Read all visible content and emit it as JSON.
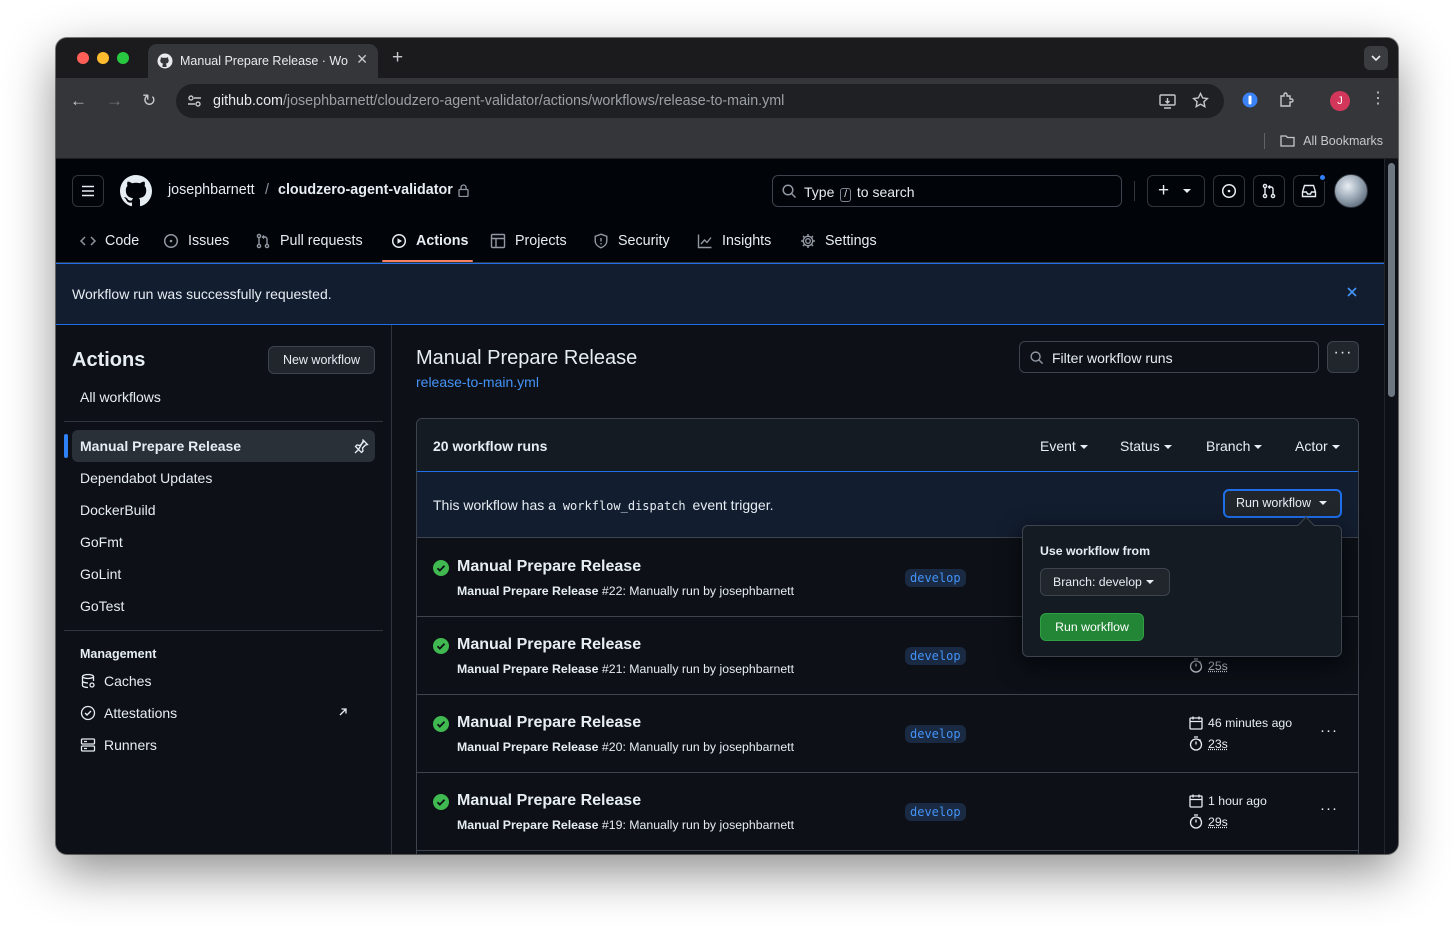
{
  "browser": {
    "tab_title": "Manual Prepare Release · Workflow runs",
    "url_domain": "github.com",
    "url_path": "/josephbarnett/cloudzero-agent-validator/actions/workflows/release-to-main.yml",
    "bookmarks_label": "All Bookmarks",
    "profile_initial": "J"
  },
  "header": {
    "owner": "josephbarnett",
    "separator": "/",
    "repo": "cloudzero-agent-validator",
    "search_prefix": "Type",
    "search_key": "/",
    "search_suffix": "to search"
  },
  "nav": {
    "tabs": [
      {
        "label": "Code",
        "icon": "code-icon"
      },
      {
        "label": "Issues",
        "icon": "issue-icon"
      },
      {
        "label": "Pull requests",
        "icon": "pull-request-icon"
      },
      {
        "label": "Actions",
        "icon": "play-icon",
        "selected": true
      },
      {
        "label": "Projects",
        "icon": "table-icon"
      },
      {
        "label": "Security",
        "icon": "shield-icon"
      },
      {
        "label": "Insights",
        "icon": "graph-icon"
      },
      {
        "label": "Settings",
        "icon": "gear-icon"
      }
    ]
  },
  "flash": {
    "message": "Workflow run was successfully requested."
  },
  "sidebar": {
    "title": "Actions",
    "new_workflow": "New workflow",
    "all_workflows": "All workflows",
    "workflows": [
      "Manual Prepare Release",
      "Dependabot Updates",
      "DockerBuild",
      "GoFmt",
      "GoLint",
      "GoTest"
    ],
    "management_heading": "Management",
    "management": [
      {
        "label": "Caches",
        "icon": "database-icon"
      },
      {
        "label": "Attestations",
        "icon": "verified-icon"
      },
      {
        "label": "Runners",
        "icon": "server-icon"
      }
    ]
  },
  "main": {
    "title": "Manual Prepare Release",
    "file": "release-to-main.yml",
    "filter_placeholder": "Filter workflow runs",
    "runs_count": "20 workflow runs",
    "filters": [
      "Event",
      "Status",
      "Branch",
      "Actor"
    ],
    "dispatch_before": "This workflow has a",
    "dispatch_code": "workflow_dispatch",
    "dispatch_after": "event trigger.",
    "run_workflow_button": "Run workflow"
  },
  "runs": [
    {
      "title": "Manual Prepare Release",
      "meta_bold": "Manual Prepare Release",
      "meta_rest": "#22: Manually run by josephbarnett",
      "branch": "develop",
      "time": "",
      "duration": ""
    },
    {
      "title": "Manual Prepare Release",
      "meta_bold": "Manual Prepare Release",
      "meta_rest": "#21: Manually run by josephbarnett",
      "branch": "develop",
      "time": "",
      "duration": "25s"
    },
    {
      "title": "Manual Prepare Release",
      "meta_bold": "Manual Prepare Release",
      "meta_rest": "#20: Manually run by josephbarnett",
      "branch": "develop",
      "time": "46 minutes ago",
      "duration": "23s"
    },
    {
      "title": "Manual Prepare Release",
      "meta_bold": "Manual Prepare Release",
      "meta_rest": "#19: Manually run by josephbarnett",
      "branch": "develop",
      "time": "1 hour ago",
      "duration": "29s"
    }
  ],
  "dropdown": {
    "label": "Use workflow from",
    "branch_button": "Branch: develop",
    "run_button": "Run workflow"
  },
  "colors": {
    "accent_blue": "#1f6feb",
    "link_blue": "#4493f8",
    "success_green": "#3fb950",
    "run_button_green": "#238636",
    "tab_underline": "#f78166",
    "background": "#0d1117"
  }
}
